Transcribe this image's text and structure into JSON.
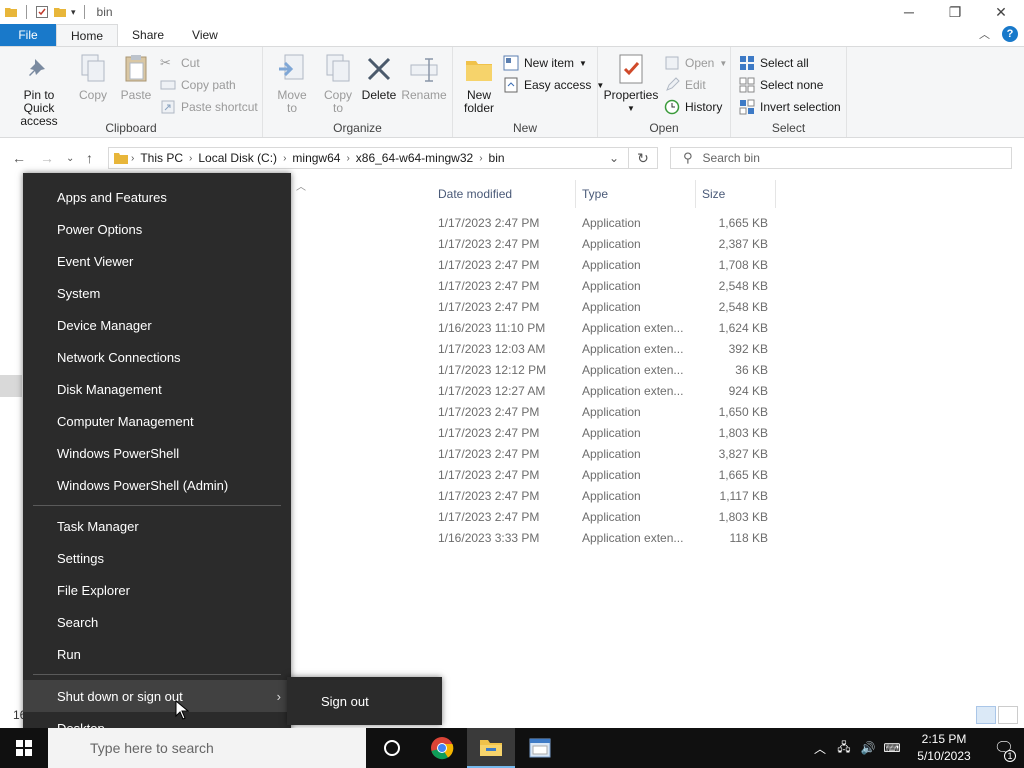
{
  "window": {
    "title": "bin"
  },
  "tabs": [
    "File",
    "Home",
    "Share",
    "View"
  ],
  "ribbon": {
    "clipboard": {
      "label": "Clipboard",
      "pin": "Pin to Quick access",
      "copy": "Copy",
      "paste": "Paste",
      "cut": "Cut",
      "copy_path": "Copy path",
      "paste_shortcut": "Paste shortcut"
    },
    "organize": {
      "label": "Organize",
      "move_to": "Move to",
      "copy_to": "Copy to",
      "delete": "Delete",
      "rename": "Rename"
    },
    "new": {
      "label": "New",
      "new_folder": "New folder",
      "new_item": "New item",
      "easy_access": "Easy access"
    },
    "open": {
      "label": "Open",
      "properties": "Properties",
      "open": "Open",
      "edit": "Edit",
      "history": "History"
    },
    "select": {
      "label": "Select",
      "select_all": "Select all",
      "select_none": "Select none",
      "invert": "Invert selection"
    }
  },
  "address": {
    "crumbs": [
      "This PC",
      "Local Disk (C:)",
      "mingw64",
      "x86_64-w64-mingw32",
      "bin"
    ],
    "search_placeholder": "Search bin"
  },
  "columns": {
    "date": "Date modified",
    "type": "Type",
    "size": "Size"
  },
  "files": [
    {
      "date": "1/17/2023 2:47 PM",
      "type": "Application",
      "size": "1,665 KB"
    },
    {
      "date": "1/17/2023 2:47 PM",
      "type": "Application",
      "size": "2,387 KB"
    },
    {
      "date": "1/17/2023 2:47 PM",
      "type": "Application",
      "size": "1,708 KB"
    },
    {
      "date": "1/17/2023 2:47 PM",
      "type": "Application",
      "size": "2,548 KB"
    },
    {
      "date": "1/17/2023 2:47 PM",
      "type": "Application",
      "size": "2,548 KB"
    },
    {
      "date": "1/16/2023 11:10 PM",
      "type": "Application exten...",
      "size": "1,624 KB"
    },
    {
      "date": "1/17/2023 12:03 AM",
      "type": "Application exten...",
      "size": "392 KB"
    },
    {
      "date": "1/17/2023 12:12 PM",
      "type": "Application exten...",
      "size": "36 KB"
    },
    {
      "date": "1/17/2023 12:27 AM",
      "type": "Application exten...",
      "size": "924 KB"
    },
    {
      "date": "1/17/2023 2:47 PM",
      "type": "Application",
      "size": "1,650 KB"
    },
    {
      "date": "1/17/2023 2:47 PM",
      "type": "Application",
      "size": "1,803 KB"
    },
    {
      "date": "1/17/2023 2:47 PM",
      "type": "Application",
      "size": "3,827 KB"
    },
    {
      "date": "1/17/2023 2:47 PM",
      "type": "Application",
      "size": "1,665 KB"
    },
    {
      "date": "1/17/2023 2:47 PM",
      "type": "Application",
      "size": "1,117 KB"
    },
    {
      "date": "1/17/2023 2:47 PM",
      "type": "Application",
      "size": "1,803 KB"
    },
    {
      "date": "1/16/2023 3:33 PM",
      "type": "Application exten...",
      "size": "118 KB"
    }
  ],
  "status": {
    "count": "16"
  },
  "winx_menu": {
    "group1": [
      "Apps and Features",
      "Power Options",
      "Event Viewer",
      "System",
      "Device Manager",
      "Network Connections",
      "Disk Management",
      "Computer Management",
      "Windows PowerShell",
      "Windows PowerShell (Admin)"
    ],
    "group2": [
      "Task Manager",
      "Settings",
      "File Explorer",
      "Search",
      "Run"
    ],
    "shutdown": "Shut down or sign out",
    "desktop": "Desktop",
    "submenu": {
      "sign_out": "Sign out"
    }
  },
  "taskbar": {
    "search_placeholder": "Type here to search",
    "time": "2:15 PM",
    "date": "5/10/2023",
    "notif_count": "1"
  },
  "colors": {
    "accent": "#1979ca",
    "menu_bg": "#2b2b2b",
    "taskbar_bg": "#101010"
  }
}
